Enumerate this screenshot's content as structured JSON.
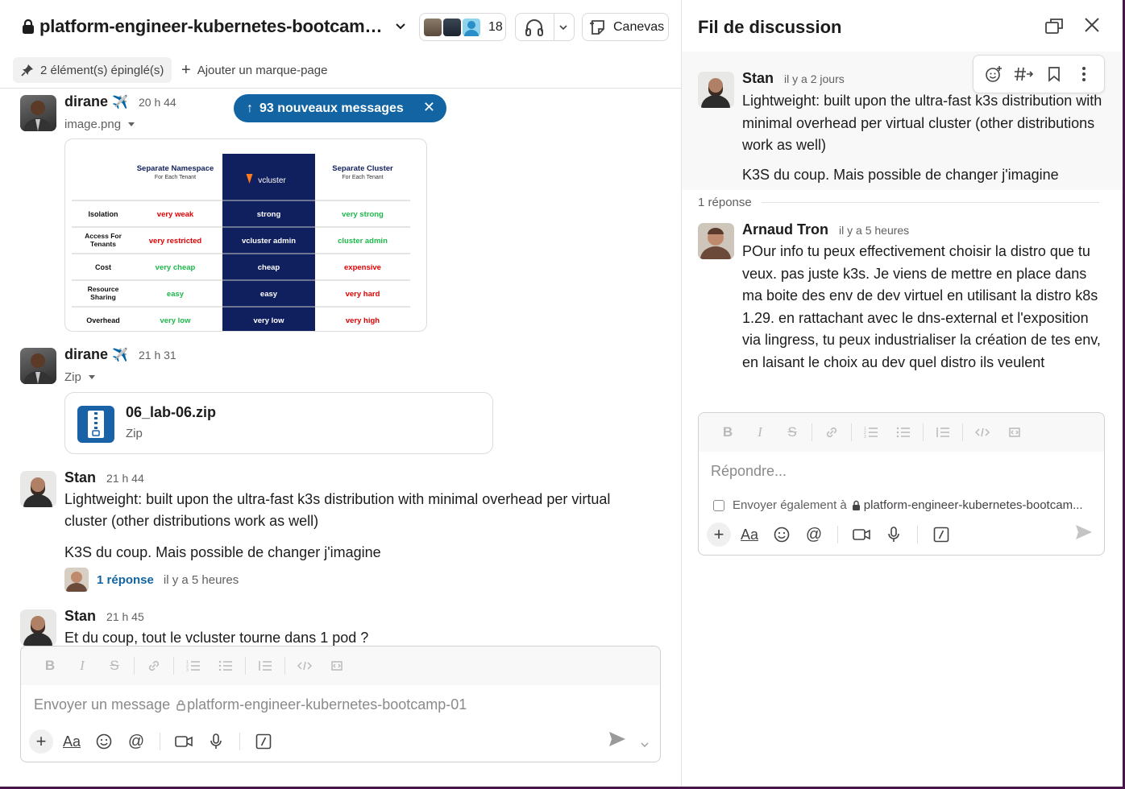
{
  "channel": {
    "name": "platform-engineer-kubernetes-bootcam…",
    "member_count": "18",
    "canvas_label": "Canevas",
    "pinned_label": "2 élément(s) épinglé(s)",
    "add_bookmark_label": "Ajouter un marque-page",
    "new_messages_label": "93 nouveaux messages"
  },
  "messages": [
    {
      "author": "dirane",
      "emoji": "✈️",
      "time": "20 h 44",
      "file_label": "image.png",
      "attachment": {
        "type": "image",
        "table": {
          "headers": [
            {
              "title": "Separate Namespace",
              "sub": "For Each Tenant"
            },
            {
              "title": "vcluster",
              "sub": ""
            },
            {
              "title": "Separate Cluster",
              "sub": "For Each Tenant"
            }
          ],
          "rows": [
            {
              "label": "Isolation",
              "cells": [
                "very weak",
                "strong",
                "very strong"
              ],
              "colors": [
                "#e00000",
                "#ffffff",
                "#1db84a"
              ]
            },
            {
              "label": "Access For Tenants",
              "cells": [
                "very restricted",
                "vcluster admin",
                "cluster admin"
              ],
              "colors": [
                "#e00000",
                "#ffffff",
                "#1db84a"
              ]
            },
            {
              "label": "Cost",
              "cells": [
                "very cheap",
                "cheap",
                "expensive"
              ],
              "colors": [
                "#1db84a",
                "#ffffff",
                "#e00000"
              ]
            },
            {
              "label": "Resource Sharing",
              "cells": [
                "easy",
                "easy",
                "very hard"
              ],
              "colors": [
                "#1db84a",
                "#ffffff",
                "#e00000"
              ]
            },
            {
              "label": "Overhead",
              "cells": [
                "very low",
                "very low",
                "very high"
              ],
              "colors": [
                "#1db84a",
                "#ffffff",
                "#e00000"
              ]
            }
          ]
        }
      }
    },
    {
      "author": "dirane",
      "emoji": "✈️",
      "time": "21 h 31",
      "file_label": "Zip",
      "attachment": {
        "type": "zip",
        "name": "06_lab-06.zip",
        "kind": "Zip"
      }
    },
    {
      "author": "Stan",
      "time": "21 h 44",
      "text1": "Lightweight: built upon the ultra-fast k3s distribution with minimal overhead per virtual cluster (other distributions work as well)",
      "text2": "K3S du coup. Mais possible de changer j'imagine",
      "reply_count": "1 réponse",
      "reply_ago": "il y a 5 heures"
    },
    {
      "author": "Stan",
      "time": "21 h 45",
      "text1": "Et du coup, tout le vcluster tourne dans 1 pod ?"
    }
  ],
  "composer": {
    "placeholder_prefix": "Envoyer un message",
    "placeholder_channel": "platform-engineer-kubernetes-bootcamp-01"
  },
  "thread": {
    "title": "Fil de discussion",
    "parent": {
      "author": "Stan",
      "time": "il y a 2 jours",
      "text1": "Lightweight: built upon the ultra-fast k3s distribution with minimal overhead per virtual cluster (other distributions work as well)",
      "text2": "K3S du coup. Mais possible de changer j'imagine"
    },
    "reply_divider": "1 réponse",
    "reply": {
      "author": "Arnaud Tron",
      "time": "il y a 5 heures",
      "text": "POur info tu peux effectivement choisir la distro que tu veux.  pas juste k3s. Je viens de mettre en place dans ma boite des env de dev virtuel en utilisant la distro k8s 1.29. en rattachant avec le dns-external et l'exposition via lingress, tu peux industrialiser la création de tes env, en laisant le choix au dev quel distro ils veulent"
    },
    "composer_placeholder": "Répondre...",
    "also_send_label": "Envoyer également à",
    "also_send_channel": "platform-engineer-kubernetes-bootcam..."
  },
  "colors": {
    "accent": "#1264a3",
    "frame": "#4a154b",
    "vcluster_bg": "#101f5e"
  }
}
